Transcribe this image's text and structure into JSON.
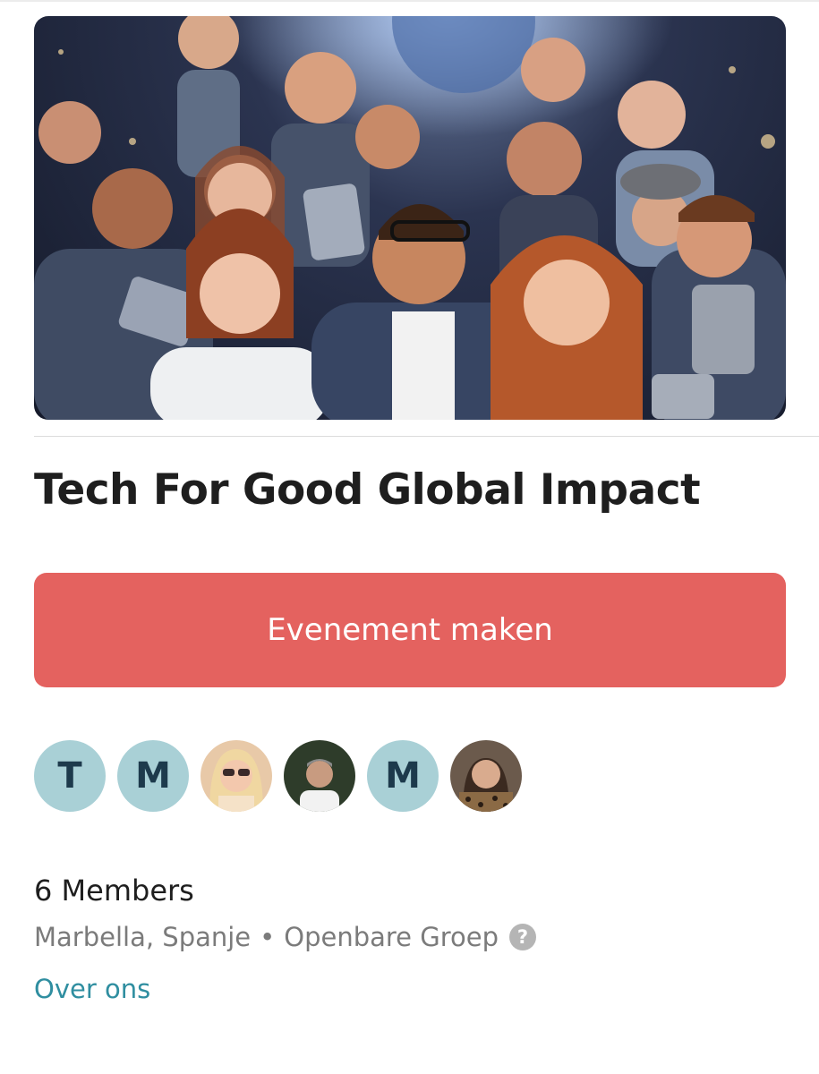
{
  "group": {
    "title": "Tech For Good Global Impact",
    "banner_image": "excited-people-with-tablets-illustration"
  },
  "actions": {
    "create_event_label": "Evenement maken",
    "accent_color": "#e4625f"
  },
  "members": {
    "count_label": "6 Members",
    "avatars": [
      {
        "type": "initial",
        "initial": "T"
      },
      {
        "type": "initial",
        "initial": "M"
      },
      {
        "type": "photo",
        "icon": "member-photo-blonde-woman"
      },
      {
        "type": "photo",
        "icon": "member-photo-man-outdoor"
      },
      {
        "type": "initial",
        "initial": "M"
      },
      {
        "type": "photo",
        "icon": "member-photo-woman-leopard"
      }
    ]
  },
  "meta": {
    "location": "Marbella, Spanje",
    "separator": "•",
    "visibility": "Openbare Groep",
    "help_icon": "?"
  },
  "links": {
    "about": "Over ons",
    "link_color": "#2f8ea0"
  }
}
